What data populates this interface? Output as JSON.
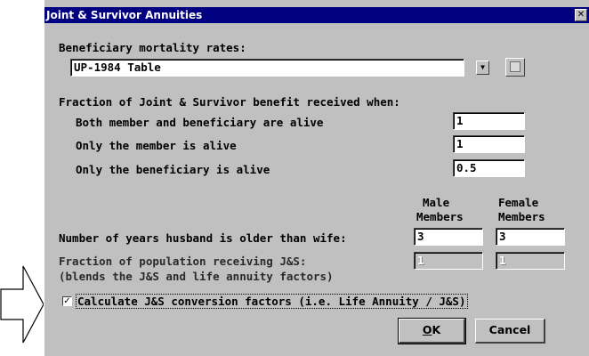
{
  "window": {
    "title": "Joint & Survivor Annuities",
    "close_glyph": "✕"
  },
  "mortality": {
    "label": "Beneficiary mortality rates:",
    "selected": "UP-1984 Table",
    "dropdown_glyph": "▼"
  },
  "fraction_section": {
    "heading": "Fraction of Joint & Survivor benefit received when:",
    "rows": [
      {
        "label": "Both member and beneficiary are alive",
        "value": "1"
      },
      {
        "label": "Only the member is alive",
        "value": "1"
      },
      {
        "label": "Only the beneficiary is alive",
        "value": "0.5"
      }
    ]
  },
  "columns": {
    "male_line1": "Male",
    "male_line2": "Members",
    "female_line1": "Female",
    "female_line2": "Members"
  },
  "years_older": {
    "label": "Number of years husband is older than wife:",
    "male": "3",
    "female": "3"
  },
  "population": {
    "label_line1": "Fraction of population receiving J&S:",
    "label_line2": "(blends the J&S and life annuity factors)",
    "male": "1",
    "female": "1"
  },
  "conversion": {
    "checked": true,
    "check_glyph": "✓",
    "label": "Calculate J&S conversion factors (i.e. Life Annuity / J&S)"
  },
  "buttons": {
    "ok_underlined": "O",
    "ok_rest": "K",
    "cancel": "Cancel"
  },
  "colors": {
    "titlebar": "#000080",
    "dialog_bg": "#c0c0c0"
  }
}
